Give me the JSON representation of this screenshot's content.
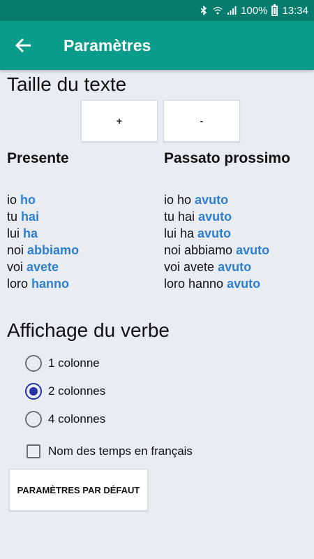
{
  "status_bar": {
    "battery": "100%",
    "time": "13:34"
  },
  "app_bar": {
    "title": "Paramètres"
  },
  "text_size": {
    "title": "Taille du texte",
    "increase_label": "+",
    "decrease_label": "-"
  },
  "preview": {
    "columns": [
      {
        "heading": "Presente",
        "rows": [
          {
            "pronoun": "io",
            "verb": "ho"
          },
          {
            "pronoun": "tu",
            "verb": "hai"
          },
          {
            "pronoun": "lui",
            "verb": "ha"
          },
          {
            "pronoun": "noi",
            "verb": "abbiamo"
          },
          {
            "pronoun": "voi",
            "verb": "avete"
          },
          {
            "pronoun": "loro",
            "verb": "hanno"
          }
        ]
      },
      {
        "heading": "Passato prossimo",
        "rows": [
          {
            "pronoun": "io ho",
            "verb": "avuto"
          },
          {
            "pronoun": "tu hai",
            "verb": "avuto"
          },
          {
            "pronoun": "lui ha",
            "verb": "avuto"
          },
          {
            "pronoun": "noi abbiamo",
            "verb": "avuto"
          },
          {
            "pronoun": "voi avete",
            "verb": "avuto"
          },
          {
            "pronoun": "loro hanno",
            "verb": "avuto"
          }
        ]
      }
    ]
  },
  "verb_display": {
    "title": "Affichage du verbe",
    "options": [
      {
        "label": "1 colonne",
        "checked": false
      },
      {
        "label": "2 colonnes",
        "checked": true
      },
      {
        "label": "4 colonnes",
        "checked": false
      }
    ],
    "french_tense_names": {
      "label": "Nom des temps en français",
      "checked": false
    }
  },
  "default_button": {
    "label": "PARAMÈTRES PAR DÉFAUT"
  },
  "colors": {
    "status_bar": "#067c6c",
    "app_bar": "#0a9c8a",
    "conjugation": "#2f7fd0",
    "radio_checked": "#2432a6",
    "background": "#e9edf1"
  }
}
